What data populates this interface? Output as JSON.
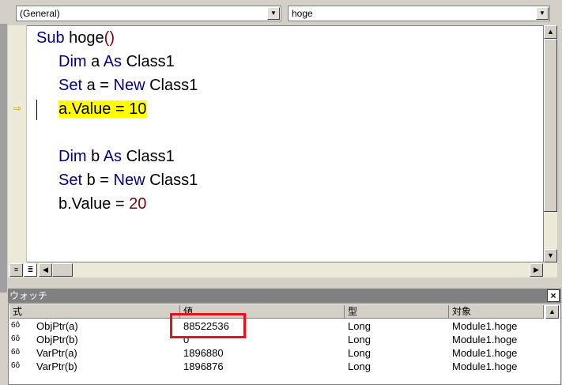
{
  "toolbar": {
    "object_combo": "(General)",
    "proc_combo": "hoge"
  },
  "code": {
    "lines": [
      {
        "indent": 0,
        "parts": [
          [
            "kw",
            "Sub "
          ],
          [
            "",
            "hoge"
          ],
          [
            "num",
            "()"
          ]
        ]
      },
      {
        "indent": 1,
        "parts": [
          [
            "kw",
            "Dim "
          ],
          [
            "",
            "a "
          ],
          [
            "kw",
            "As "
          ],
          [
            "",
            "Class1"
          ]
        ]
      },
      {
        "indent": 1,
        "parts": [
          [
            "kw",
            "Set "
          ],
          [
            "",
            "a = "
          ],
          [
            "kw",
            "New "
          ],
          [
            "",
            "Class1"
          ]
        ]
      },
      {
        "indent": 1,
        "parts": [
          [
            "hl",
            "a.Value = 10"
          ]
        ]
      },
      {
        "indent": 0,
        "parts": []
      },
      {
        "indent": 1,
        "parts": [
          [
            "kw",
            "Dim "
          ],
          [
            "",
            "b "
          ],
          [
            "kw",
            "As "
          ],
          [
            "",
            "Class1"
          ]
        ]
      },
      {
        "indent": 1,
        "parts": [
          [
            "kw",
            "Set "
          ],
          [
            "",
            "b = "
          ],
          [
            "kw",
            "New "
          ],
          [
            "",
            "Class1"
          ]
        ]
      },
      {
        "indent": 1,
        "parts": [
          [
            "",
            "b.Value = "
          ],
          [
            "num",
            "20"
          ]
        ]
      }
    ]
  },
  "watch": {
    "title": "ウォッチ",
    "close": "×",
    "headers": [
      "式",
      "値",
      "型",
      "対象"
    ],
    "rows": [
      {
        "expr": "ObjPtr(a)",
        "value": "88522536",
        "type": "Long",
        "context": "Module1.hoge"
      },
      {
        "expr": "ObjPtr(b)",
        "value": "0",
        "type": "Long",
        "context": "Module1.hoge"
      },
      {
        "expr": "VarPtr(a)",
        "value": "1896880",
        "type": "Long",
        "context": "Module1.hoge"
      },
      {
        "expr": "VarPtr(b)",
        "value": "1896876",
        "type": "Long",
        "context": "Module1.hoge"
      }
    ]
  },
  "colors": {
    "highlight": "#ffff00",
    "keyword": "#00007f",
    "number": "#7f0000",
    "annotation": "#e8101b"
  }
}
